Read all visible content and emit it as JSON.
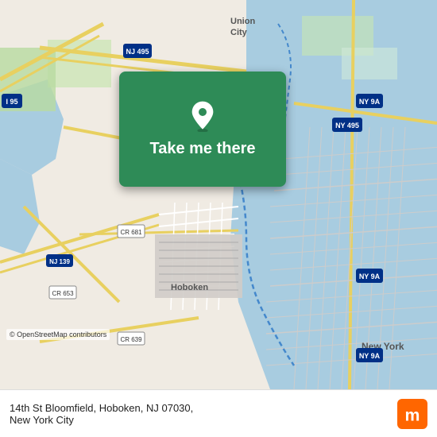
{
  "map": {
    "background_color": "#e8e0d8"
  },
  "card": {
    "label": "Take me there",
    "background_color": "#2e8b57"
  },
  "bottom_bar": {
    "address_line1": "14th St Bloomfield, Hoboken, NJ 07030,",
    "address_line2": "New York City"
  },
  "osm_credit": {
    "text": "© OpenStreetMap contributors"
  },
  "moovit": {
    "label": "moovit"
  }
}
